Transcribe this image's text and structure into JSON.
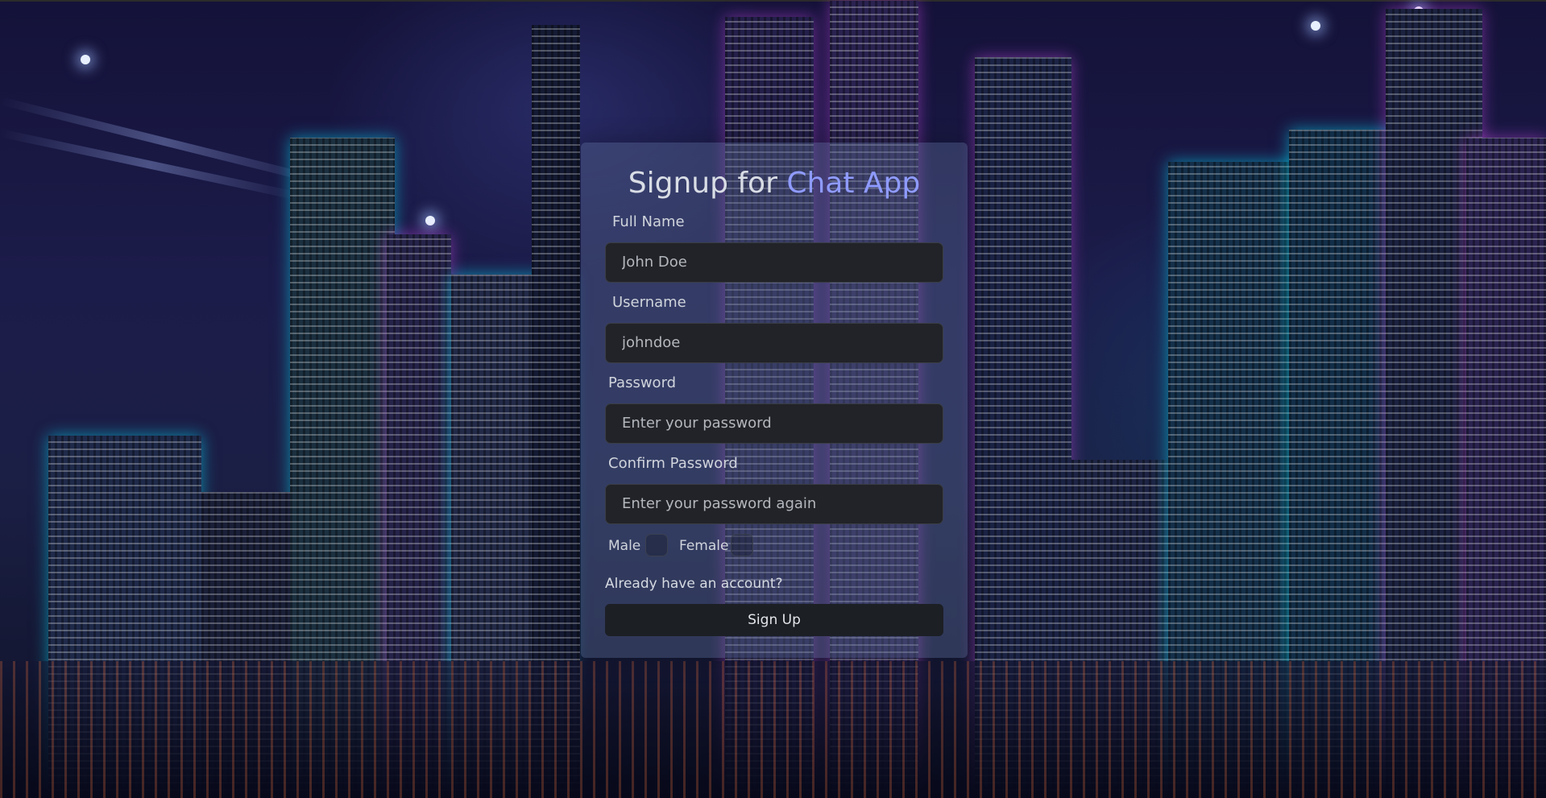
{
  "signup_form": {
    "title_prefix": "Signup for",
    "title_accent": "Chat App",
    "full_name": {
      "label": "Full Name",
      "placeholder": "John Doe",
      "value": ""
    },
    "username": {
      "label": "Username",
      "placeholder": "johndoe",
      "value": ""
    },
    "password": {
      "label": "Password",
      "placeholder": "Enter your password",
      "value": ""
    },
    "confirm_password": {
      "label": "Confirm Password",
      "placeholder": "Enter your password again",
      "value": ""
    },
    "gender": {
      "male_label": "Male",
      "female_label": "Female",
      "male_checked": false,
      "female_checked": false
    },
    "login_link": "Already have an account?",
    "submit_label": "Sign Up"
  },
  "colors": {
    "accent": "#8f9bff",
    "card_bg": "rgba(92,110,150,0.38)",
    "field_bg": "#212328",
    "button_bg": "#1c1f24"
  }
}
